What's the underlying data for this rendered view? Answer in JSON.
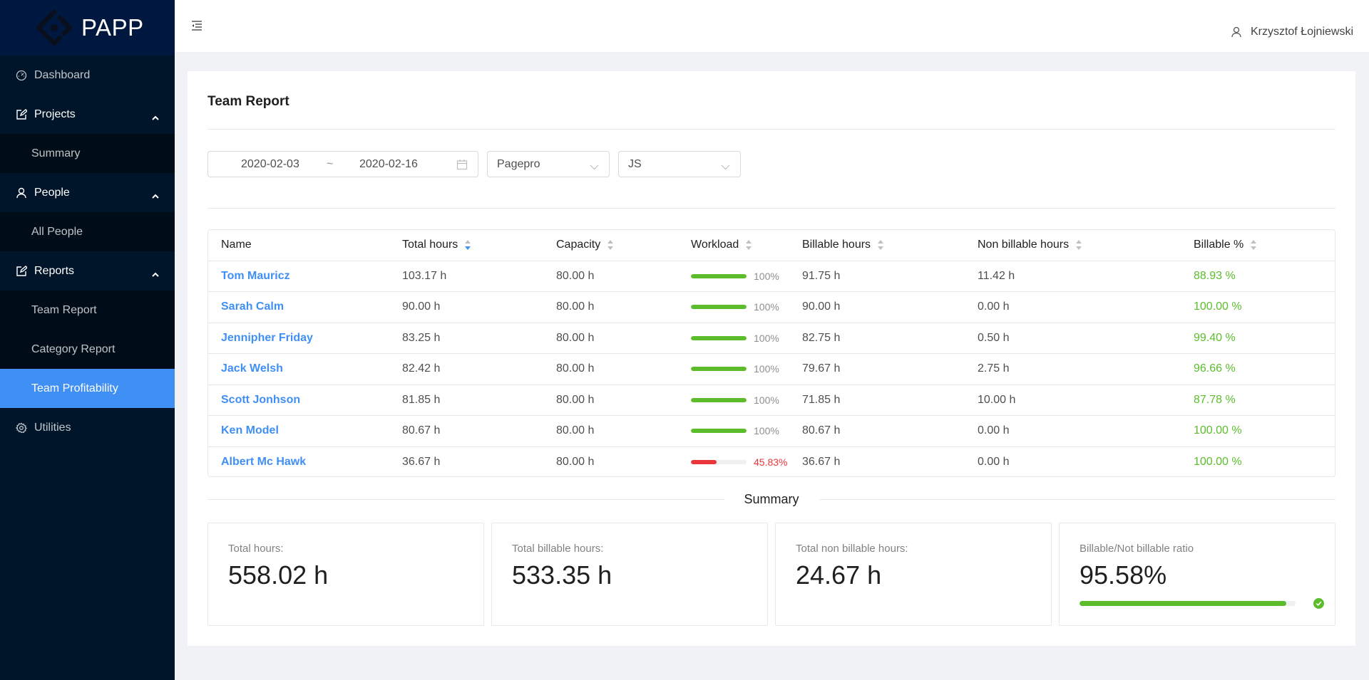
{
  "app": {
    "name": "PAPP"
  },
  "sidebar": {
    "items": [
      {
        "label": "Dashboard",
        "icon": "dashboard-icon"
      },
      {
        "label": "Projects",
        "icon": "edit-icon",
        "expanded": true,
        "children": [
          {
            "label": "Summary"
          }
        ]
      },
      {
        "label": "People",
        "icon": "user-icon",
        "expanded": true,
        "children": [
          {
            "label": "All People"
          }
        ]
      },
      {
        "label": "Reports",
        "icon": "edit-icon",
        "expanded": true,
        "children": [
          {
            "label": "Team Report"
          },
          {
            "label": "Category Report"
          },
          {
            "label": "Team Profitability",
            "active": true
          }
        ]
      },
      {
        "label": "Utilities",
        "icon": "gear-icon"
      }
    ]
  },
  "header": {
    "collapse_icon": "menu-fold-icon",
    "user_name": "Krzysztof Łojniewski"
  },
  "page": {
    "title": "Team Report",
    "filters": {
      "date_from": "2020-02-03",
      "date_separator": "~",
      "date_to": "2020-02-16",
      "company": "Pagepro",
      "team": "JS"
    }
  },
  "table": {
    "columns": [
      {
        "label": "Name",
        "sortable": false
      },
      {
        "label": "Total hours",
        "sortable": true,
        "sort": "desc"
      },
      {
        "label": "Capacity",
        "sortable": true
      },
      {
        "label": "Workload",
        "sortable": true
      },
      {
        "label": "Billable hours",
        "sortable": true
      },
      {
        "label": "Non billable hours",
        "sortable": true
      },
      {
        "label": "Billable %",
        "sortable": true
      }
    ],
    "rows": [
      {
        "name": "Tom Mauricz",
        "total": "103.17 h",
        "capacity": "80.00 h",
        "workload": 100,
        "workload_label": "100%",
        "billable": "91.75 h",
        "non_billable": "11.42 h",
        "billable_pct": "88.93 %"
      },
      {
        "name": "Sarah Calm",
        "total": "90.00 h",
        "capacity": "80.00 h",
        "workload": 100,
        "workload_label": "100%",
        "billable": "90.00 h",
        "non_billable": "0.00 h",
        "billable_pct": "100.00 %"
      },
      {
        "name": "Jennipher Friday",
        "total": "83.25 h",
        "capacity": "80.00 h",
        "workload": 100,
        "workload_label": "100%",
        "billable": "82.75 h",
        "non_billable": "0.50 h",
        "billable_pct": "99.40 %"
      },
      {
        "name": "Jack Welsh",
        "total": "82.42 h",
        "capacity": "80.00 h",
        "workload": 100,
        "workload_label": "100%",
        "billable": "79.67 h",
        "non_billable": "2.75 h",
        "billable_pct": "96.66 %"
      },
      {
        "name": "Scott Jonhson",
        "total": "81.85 h",
        "capacity": "80.00 h",
        "workload": 100,
        "workload_label": "100%",
        "billable": "71.85 h",
        "non_billable": "10.00 h",
        "billable_pct": "87.78 %"
      },
      {
        "name": "Ken Model",
        "total": "80.67 h",
        "capacity": "80.00 h",
        "workload": 100,
        "workload_label": "100%",
        "billable": "80.67 h",
        "non_billable": "0.00 h",
        "billable_pct": "100.00 %"
      },
      {
        "name": "Albert Mc Hawk",
        "total": "36.67 h",
        "capacity": "80.00 h",
        "workload": 45.83,
        "workload_label": "45.83%",
        "billable": "36.67 h",
        "non_billable": "0.00 h",
        "billable_pct": "100.00 %"
      }
    ]
  },
  "summary": {
    "title": "Summary",
    "cards": [
      {
        "label": "Total hours:",
        "value": "558.02 h"
      },
      {
        "label": "Total billable hours:",
        "value": "533.35 h"
      },
      {
        "label": "Total non billable hours:",
        "value": "24.67 h"
      },
      {
        "label": "Billable/Not billable ratio",
        "value": "95.58%",
        "progress": 95.58
      }
    ]
  },
  "colors": {
    "accent": "#3f8ff5",
    "success": "#5cbd2c",
    "danger": "#e8363a",
    "sidebar_bg": "#001529",
    "logo_bg": "#001740"
  }
}
